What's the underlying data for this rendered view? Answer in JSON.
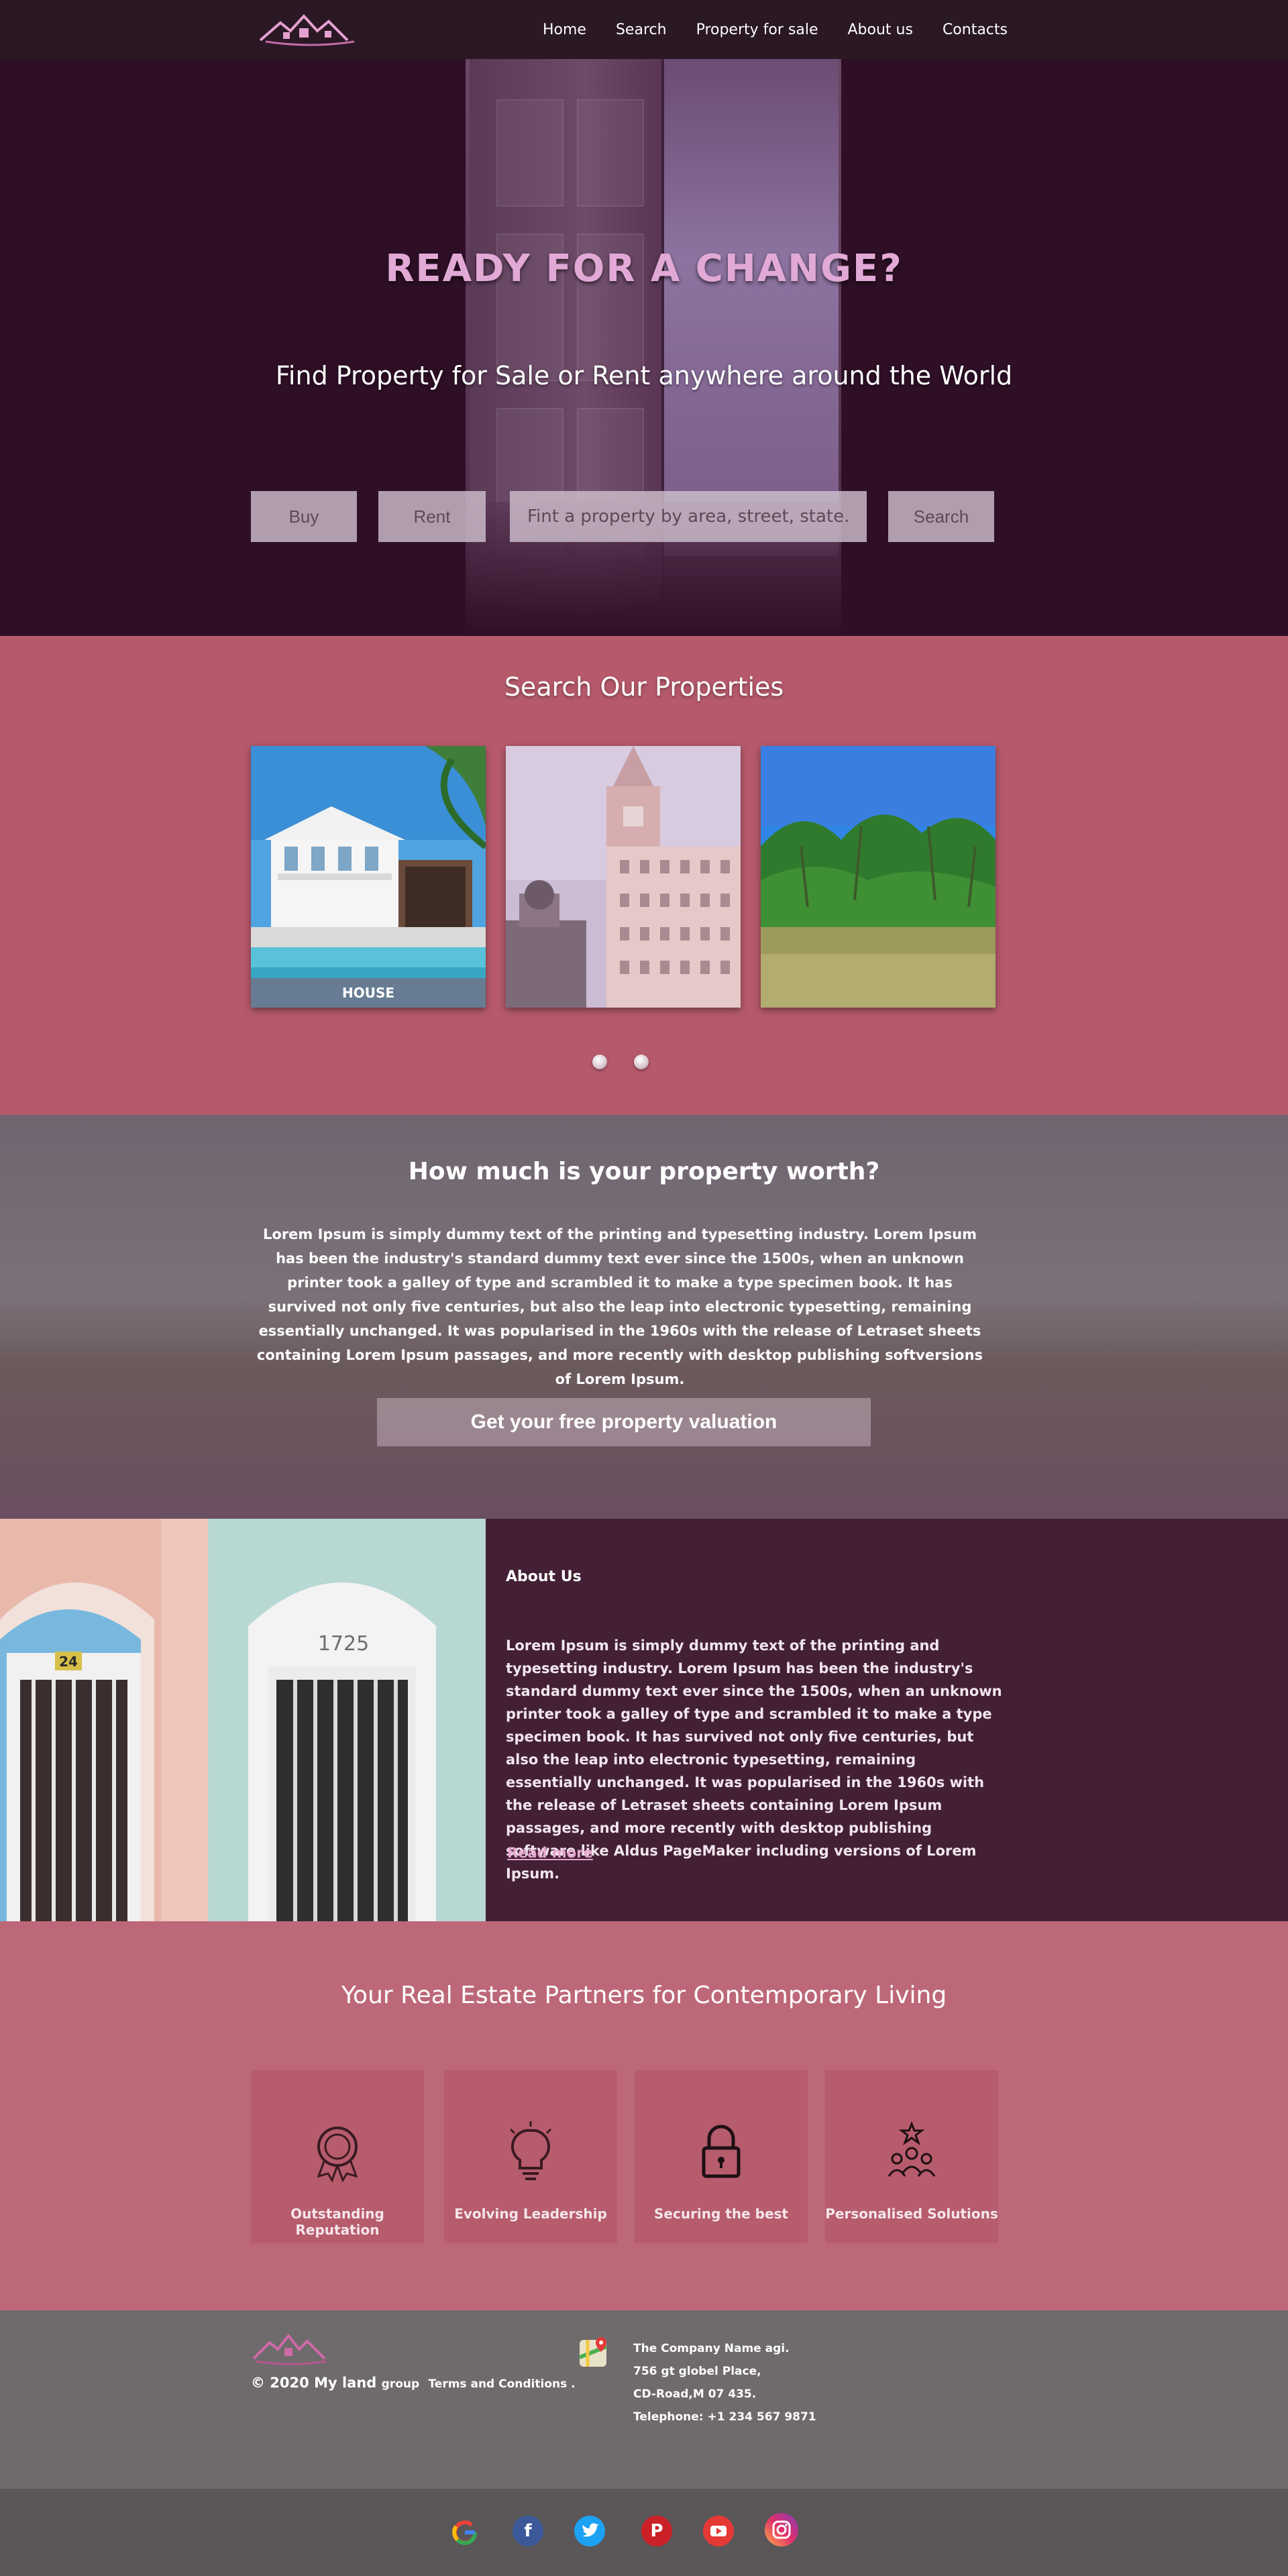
{
  "nav": {
    "items": [
      {
        "label": "Home"
      },
      {
        "label": "Search"
      },
      {
        "label": "Property for sale"
      },
      {
        "label": "About us"
      },
      {
        "label": "Contacts"
      }
    ]
  },
  "hero": {
    "title": "READY FOR A CHANGE?",
    "subtitle": "Find  Property for Sale or Rent anywhere around the World",
    "buy_label": "Buy",
    "rent_label": "Rent",
    "search_placeholder": "Fint a property by area, street, state.",
    "search_label": "Search"
  },
  "properties": {
    "title": "Search Our Properties",
    "cards": [
      {
        "label": "HOUSE"
      },
      {
        "label": ""
      },
      {
        "label": ""
      }
    ]
  },
  "valuation": {
    "title": "How much is your property worth?",
    "text": "Lorem Ipsum is simply dummy text of the printing and typesetting industry. Lorem Ipsum has been the industry's standard dummy text ever since the 1500s, when an unknown printer took a galley of type and scrambled it to make a type specimen book. It has survived not only five centuries, but also the leap into electronic typesetting, remaining essentially unchanged. It was popularised in the 1960s with the release of Letraset sheets containing Lorem Ipsum passages, and more recently with desktop publishing softversions of Lorem Ipsum.",
    "button_label": "Get your free property valuation"
  },
  "about": {
    "heading": "About Us",
    "text": "Lorem Ipsum is simply dummy text of the printing and typesetting industry. Lorem Ipsum has been the industry's standard dummy text ever since the 1500s, when an unknown printer took a galley of type and scrambled it to make a type specimen book. It has survived not only five centuries, but also the leap into electronic typesetting, remaining essentially unchanged. It was popularised in the 1960s with the release of Letraset sheets containing Lorem Ipsum passages, and more recently with desktop publishing software like Aldus PageMaker including versions of Lorem Ipsum.",
    "read_more": "Read more",
    "door_number_left": "24",
    "door_number_right": "1725"
  },
  "partners": {
    "title": "Your Real Estate Partners for Contemporary Living",
    "features": [
      {
        "label": "Outstanding Reputation",
        "icon": "award-medal-icon"
      },
      {
        "label": "Evolving Leadership",
        "icon": "lightbulb-icon"
      },
      {
        "label": "Securing the best",
        "icon": "padlock-icon"
      },
      {
        "label": "Personalised Solutions",
        "icon": "team-star-icon"
      }
    ]
  },
  "footer": {
    "copyright": "© 2020 My land",
    "group": "group",
    "terms": "Terms and Conditions .",
    "address": [
      "The Company Name agi.",
      "756 gt globel Place,",
      "CD-Road,M 07 435.",
      "Telephone: +1 234 567 9871"
    ]
  },
  "social": {
    "icons": [
      "google-icon",
      "facebook-icon",
      "twitter-icon",
      "pinterest-icon",
      "youtube-icon",
      "instagram-icon"
    ]
  },
  "colors": {
    "hero_bg": "#2e0f26",
    "properties_bg": "#b65a6b",
    "about_bg": "#432035",
    "partners_bg": "#bd6878",
    "accent_title": "#e2a9d6"
  }
}
